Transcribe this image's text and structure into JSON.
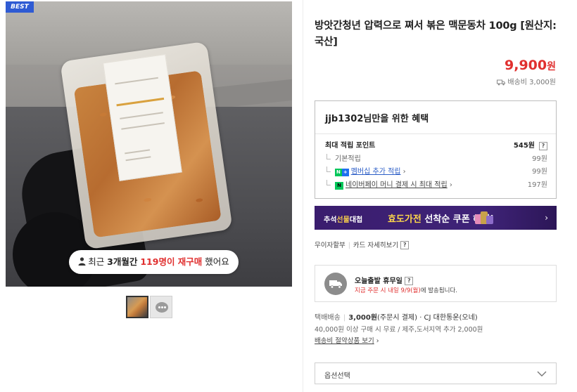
{
  "badge": "BEST",
  "rebuy": {
    "prefix": "최근 ",
    "period": "3개월간",
    "count": "119명이 재구매",
    "suffix": " 했어요"
  },
  "product": {
    "title": "방앗간청년 압력으로 쪄서 볶은 맥문동차 100g [원산지: 국산]",
    "price": "9,900",
    "price_unit": "원",
    "shipping_fee": "배송비 3,000원"
  },
  "benefit": {
    "title": "jjb1302님만을 위한 혜택",
    "max_points_label": "최대 적립 포인트",
    "max_points_value": "545원",
    "help": "?",
    "rows": [
      {
        "label": "기본적립",
        "value": "99원"
      },
      {
        "label": "멤버십 추가 적립",
        "value": "99원"
      },
      {
        "label": "네이버페이 머니 결제 시 최대 적립",
        "value": "197원"
      }
    ]
  },
  "banner": {
    "prefix": "추석",
    "prefix_accent": "선물",
    "prefix_suffix": "대첩",
    "accent": "효도가전",
    "text": " 선착순 쿠폰 혜택!",
    "chevron": "›"
  },
  "installment": {
    "label": "무이자할부",
    "card_link": "카드 자세히보기",
    "help": "?"
  },
  "today": {
    "title": "오늘출발 휴무일",
    "help": "?",
    "sub_highlight": "지금 주문 시 내일 9/9(월)",
    "sub_rest": "에 발송됩니다."
  },
  "delivery": {
    "label": "택배배송",
    "fee": "3,000원",
    "fee_note": "(주문시 결제)",
    "carrier": "· CJ 대한통운(오네)",
    "condition": "40,000원 이상 구매 시 무료 / 제주,도서지역 추가 2,000원",
    "saving_link": "배송비 절약상품 보기",
    "chevron": "›"
  },
  "option": {
    "placeholder": "옵션선택"
  },
  "colors": {
    "price": "#e0302f",
    "banner_bg": "#3a1d6e",
    "best_badge": "#2f5bd3",
    "naver_green": "#03c75a"
  }
}
